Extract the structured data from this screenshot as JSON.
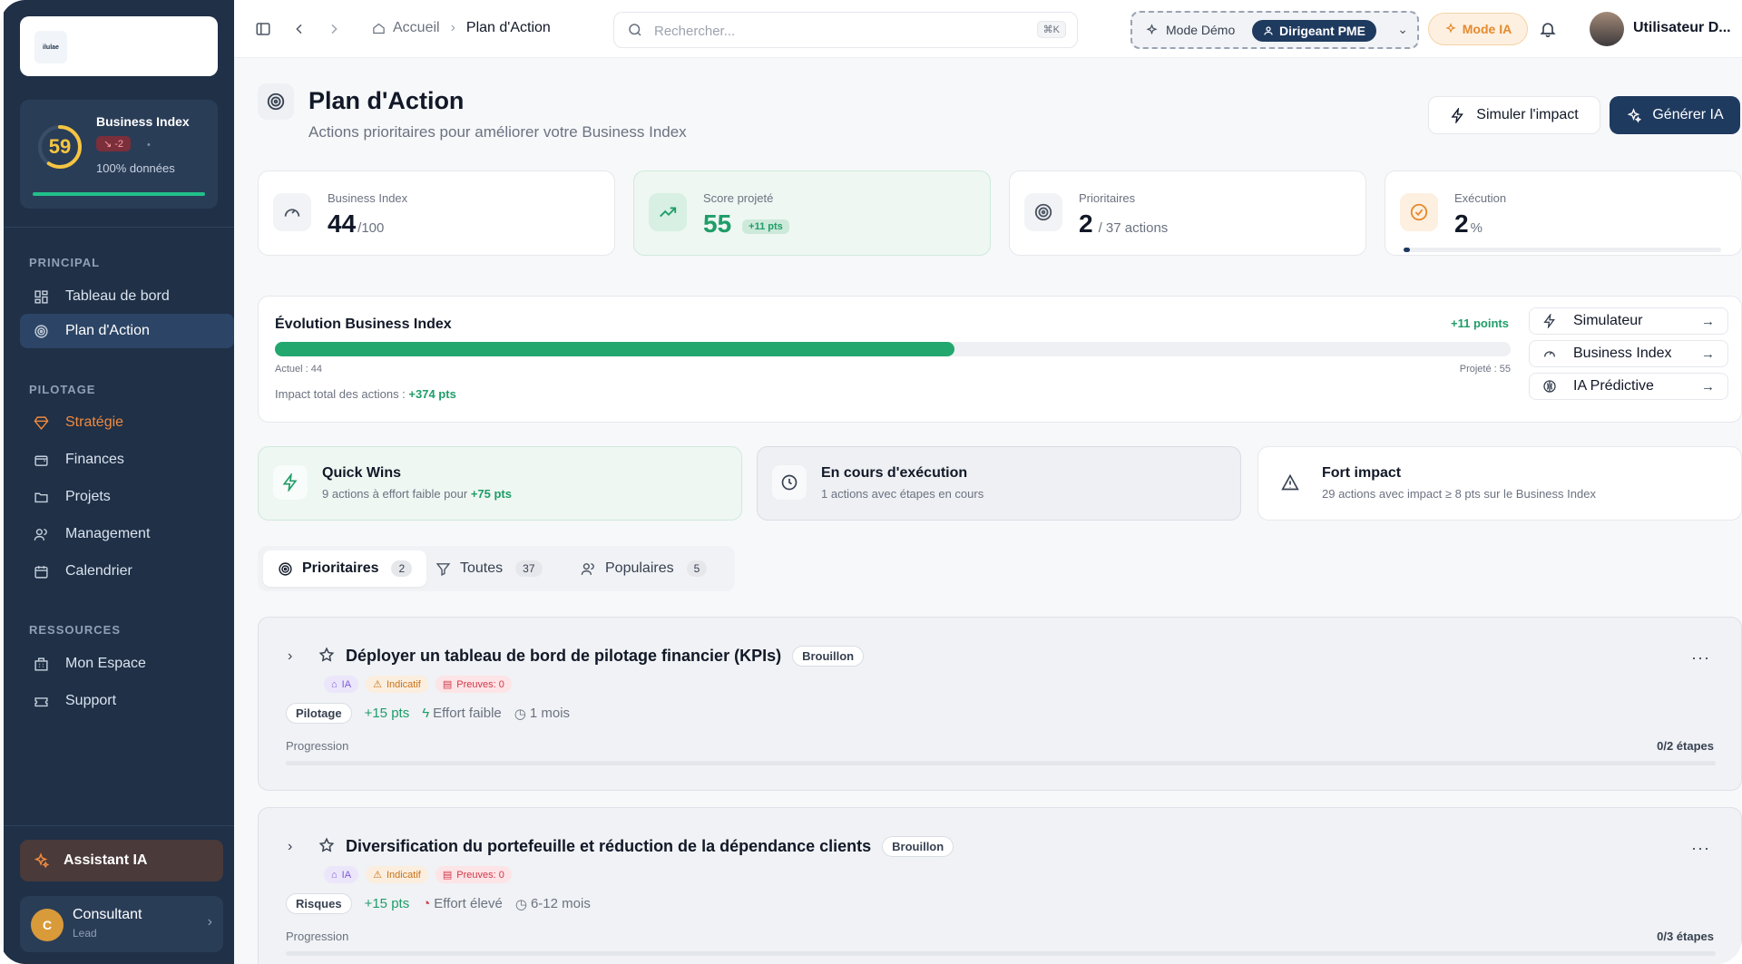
{
  "colors": {
    "sidebar": "#1f3047",
    "accent_green": "#1f9d68",
    "accent_orange": "#e58a2f",
    "primary": "#1f3a5f"
  },
  "sidebar": {
    "logo_text": "ilulae",
    "business_index": {
      "score": "59",
      "title": "Business Index",
      "delta": "↘ -2",
      "dot": "•",
      "data_label": "100% données",
      "data_fraction": 1.0
    },
    "sections": [
      {
        "title": "PRINCIPAL",
        "items": [
          {
            "label": "Tableau de bord",
            "icon": "dashboard-icon"
          },
          {
            "label": "Plan d'Action",
            "icon": "target-icon",
            "active": true
          }
        ]
      },
      {
        "title": "PILOTAGE",
        "items": [
          {
            "label": "Stratégie",
            "icon": "diamond-icon"
          },
          {
            "label": "Finances",
            "icon": "wallet-icon"
          },
          {
            "label": "Projets",
            "icon": "folder-icon"
          },
          {
            "label": "Management",
            "icon": "users-icon"
          },
          {
            "label": "Calendrier",
            "icon": "calendar-icon"
          }
        ]
      },
      {
        "title": "RESSOURCES",
        "items": [
          {
            "label": "Mon Espace",
            "icon": "building-icon"
          },
          {
            "label": "Support",
            "icon": "ticket-icon"
          }
        ]
      }
    ],
    "assistant": "Assistant IA",
    "consultant": {
      "initial": "C",
      "name": "Consultant",
      "role": "Lead"
    }
  },
  "topbar": {
    "crumbs": [
      "Accueil",
      "Plan d'Action"
    ],
    "search_placeholder": "Rechercher...",
    "search_shortcut": "⌘K",
    "demo_label": "Mode Démo",
    "demo_role": "Dirigeant PME",
    "mode_ia": "Mode IA",
    "user_name": "Utilisateur D..."
  },
  "page": {
    "title": "Plan d'Action",
    "subtitle": "Actions prioritaires pour améliorer votre Business Index",
    "simulate_btn": "Simuler l'impact",
    "generate_btn": "Générer IA"
  },
  "kpis": [
    {
      "label": "Business Index",
      "value": "44",
      "unit": "/100"
    },
    {
      "label": "Score projeté",
      "value": "55",
      "chip": "+11 pts"
    },
    {
      "label": "Prioritaires",
      "value": "2",
      "unit": "/ 37 actions"
    },
    {
      "label": "Exécution",
      "value": "2",
      "unit": "%",
      "progress": 0.02
    }
  ],
  "evolution": {
    "title": "Évolution Business Index",
    "gain": "+11 points",
    "actual": "Actuel : 44",
    "projected": "Projeté : 55",
    "fill_fraction": 0.55,
    "impact_label": "Impact total des actions : ",
    "impact_value": "+374 pts",
    "links": [
      "Simulateur",
      "Business Index",
      "IA Prédictive"
    ]
  },
  "summaries": [
    {
      "title": "Quick Wins",
      "desc": "9 actions à effort faible pour ",
      "highlight": "+75 pts"
    },
    {
      "title": "En cours d'exécution",
      "desc": "1 actions avec étapes en cours"
    },
    {
      "title": "Fort impact",
      "desc": "29 actions avec impact ≥ 8 pts sur le Business Index"
    }
  ],
  "tabs": [
    {
      "label": "Prioritaires",
      "count": "2"
    },
    {
      "label": "Toutes",
      "count": "37"
    },
    {
      "label": "Populaires",
      "count": "5"
    }
  ],
  "actions": [
    {
      "title": "Déployer un tableau de bord de pilotage financier (KPIs)",
      "status": "Brouillon",
      "badges": [
        "IA",
        "Indicatif",
        "Preuves: 0"
      ],
      "category": "Pilotage",
      "points": "+15 pts",
      "effort": "Effort faible",
      "duration": "1 mois",
      "progress_label": "Progression",
      "steps": "0/2 étapes"
    },
    {
      "title": "Diversification du portefeuille et réduction de la dépendance clients",
      "status": "Brouillon",
      "badges": [
        "IA",
        "Indicatif",
        "Preuves: 0"
      ],
      "category": "Risques",
      "points": "+15 pts",
      "effort": "Effort élevé",
      "duration": "6-12 mois",
      "progress_label": "Progression",
      "steps": "0/3 étapes"
    }
  ]
}
